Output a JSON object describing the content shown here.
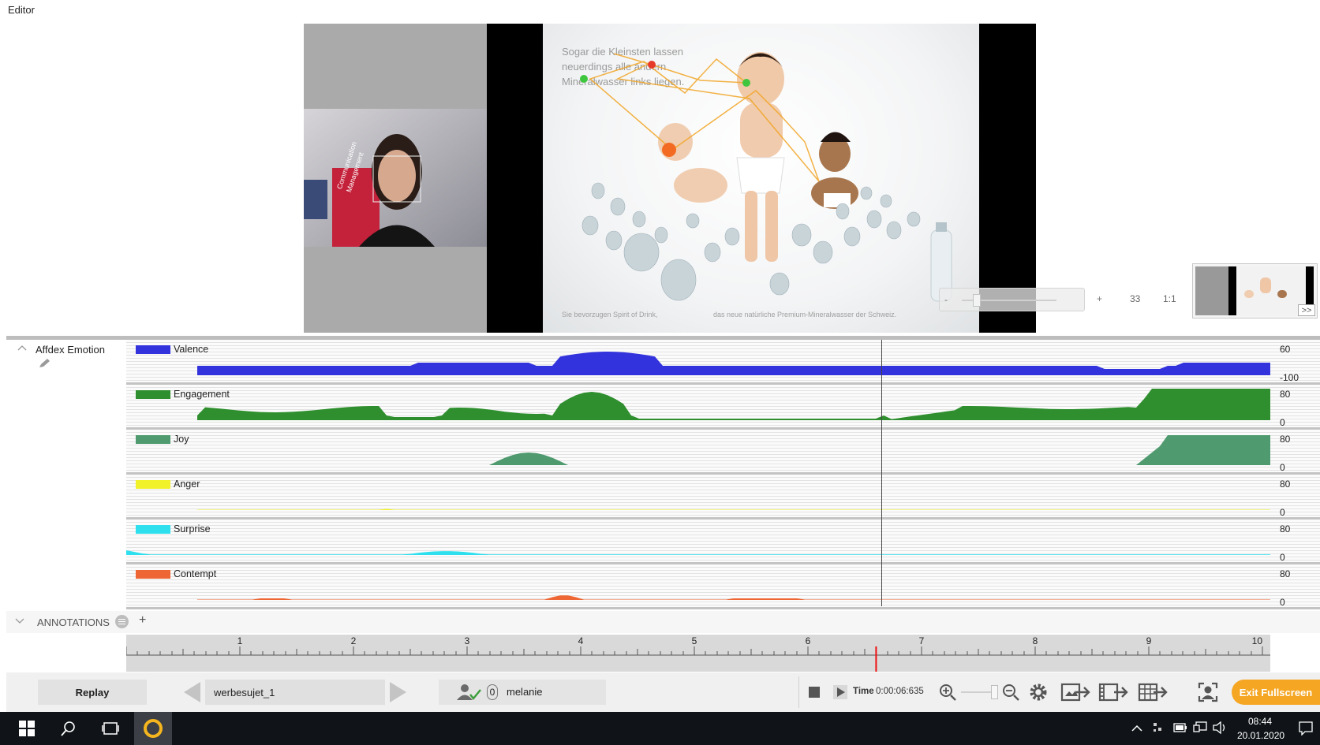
{
  "window": {
    "title": "Editor"
  },
  "stimulus": {
    "headline_lines": [
      "Sogar die Kleinsten lassen",
      "neuerdings alle andern",
      "Mineralwasser links liegen."
    ],
    "footer_left": "Sie bevorzugen Spirit of Drink,",
    "footer_right": "das neue natürliche Premium-Mineralwasser der Schweiz."
  },
  "webcam": {
    "banner_line1": "Communication",
    "banner_line2": "Management"
  },
  "zoom_strip": {
    "minus": "-",
    "plus": "+",
    "value": "33",
    "ratio": "1:1"
  },
  "thumbnail": {
    "expand_label": ">>"
  },
  "emotion_panel": {
    "title": "Affdex Emotion",
    "rows": [
      {
        "name": "Valence",
        "color": "#3333dd",
        "max": "60",
        "min": "-100"
      },
      {
        "name": "Engagement",
        "color": "#2f8f2f",
        "max": "80",
        "min": "0"
      },
      {
        "name": "Joy",
        "color": "#4f9a6e",
        "max": "80",
        "min": "0"
      },
      {
        "name": "Anger",
        "color": "#f2f22a",
        "max": "80",
        "min": "0"
      },
      {
        "name": "Surprise",
        "color": "#2ee0ee",
        "max": "80",
        "min": "0"
      },
      {
        "name": "Contempt",
        "color": "#ee6633",
        "max": "80",
        "min": "0"
      }
    ]
  },
  "annotations": {
    "label": "ANNOTATIONS",
    "add": "+"
  },
  "timeline": {
    "ticks": [
      "1",
      "2",
      "3",
      "4",
      "5",
      "6",
      "7",
      "8",
      "9",
      "10"
    ],
    "playhead_time": 6.6
  },
  "controls": {
    "replay": "Replay",
    "stimulus_name": "werbesujet_1",
    "participant_count": "0",
    "participant_name": "melanie",
    "time_label": "Time",
    "time_value": "0:00:06:635",
    "exit_fullscreen": "Exit Fullscreen"
  },
  "taskbar": {
    "time": "08:44",
    "date": "20.01.2020"
  }
}
